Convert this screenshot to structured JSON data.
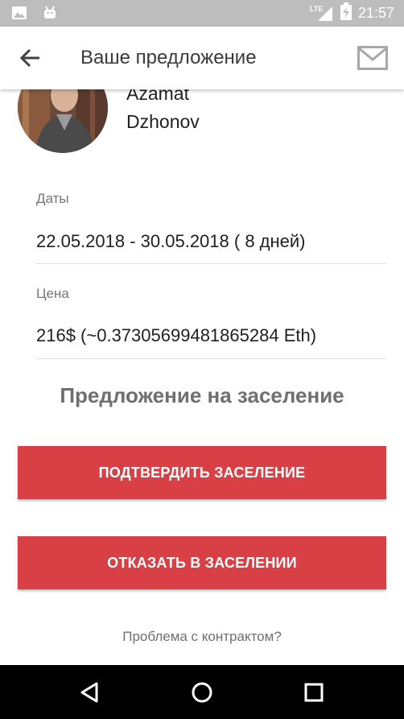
{
  "status_bar": {
    "time": "21:57",
    "network_label": "LTE",
    "icons": [
      "gallery-icon",
      "android-icon",
      "signal-icon",
      "battery-icon"
    ]
  },
  "app_bar": {
    "title": "Ваше предложение",
    "icons": [
      "back-arrow-icon",
      "mail-icon"
    ]
  },
  "profile": {
    "first_name": "Azamat",
    "last_name": "Dzhonov"
  },
  "fields": {
    "dates_label": "Даты",
    "dates_value": "22.05.2018 - 30.05.2018 ( 8 дней)",
    "price_label": "Цена",
    "price_value": "216$ (~0.37305699481865284 Eth)"
  },
  "offer": {
    "heading": "Предложение на заселение",
    "confirm_label": "ПОДТВЕРДИТЬ ЗАСЕЛЕНИЕ",
    "decline_label": "ОТКАЗАТЬ В ЗАСЕЛЕНИИ",
    "problem_link": "Проблема с контрактом?"
  },
  "nav_bar": {
    "icons": [
      "back-triangle-icon",
      "home-circle-icon",
      "recents-square-icon"
    ]
  },
  "colors": {
    "accent": "#d94045",
    "status_bar": "#bdbdbd",
    "nav_bar": "#000000",
    "heading_gray": "#6f6f6f"
  }
}
